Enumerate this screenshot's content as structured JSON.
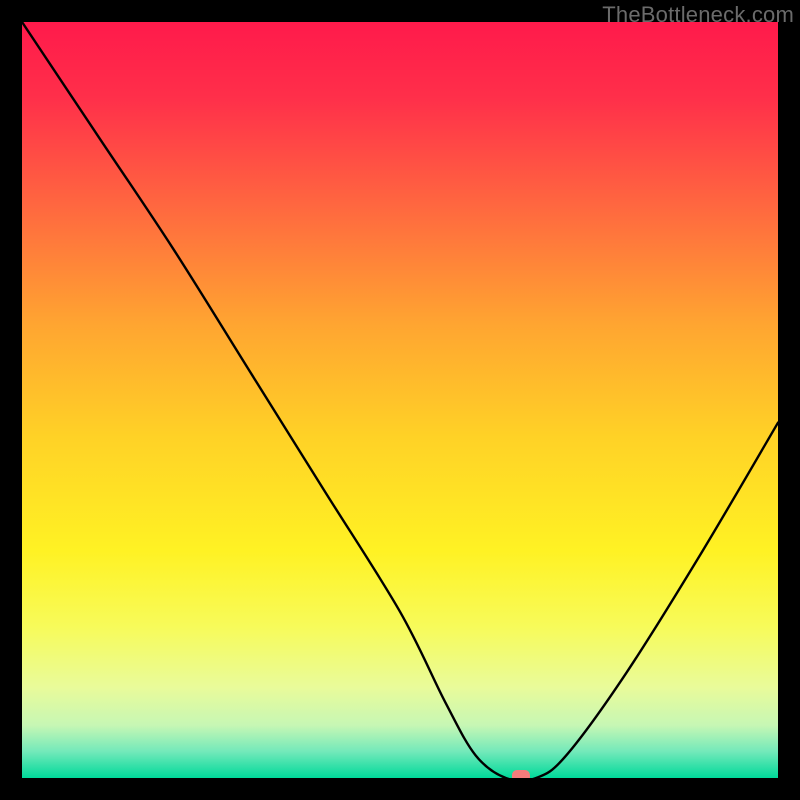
{
  "watermark": "TheBottleneck.com",
  "chart_data": {
    "type": "line",
    "title": "",
    "xlabel": "",
    "ylabel": "",
    "xlim": [
      0,
      100
    ],
    "ylim": [
      0,
      100
    ],
    "series": [
      {
        "name": "bottleneck-curve",
        "x": [
          0,
          10,
          20,
          30,
          40,
          50,
          56,
          60,
          64,
          68,
          72,
          80,
          90,
          100
        ],
        "y": [
          100,
          85,
          70,
          54,
          38,
          22,
          10,
          3,
          0,
          0,
          3,
          14,
          30,
          47
        ]
      }
    ],
    "marker": {
      "x": 66,
      "y": 0,
      "color": "#f47c7c"
    },
    "background_gradient": {
      "stops": [
        {
          "offset": 0.0,
          "color": "#ff1a4b"
        },
        {
          "offset": 0.1,
          "color": "#ff2f4a"
        },
        {
          "offset": 0.25,
          "color": "#ff6a3f"
        },
        {
          "offset": 0.4,
          "color": "#ffa531"
        },
        {
          "offset": 0.55,
          "color": "#ffd226"
        },
        {
          "offset": 0.7,
          "color": "#fff224"
        },
        {
          "offset": 0.8,
          "color": "#f7fb5a"
        },
        {
          "offset": 0.88,
          "color": "#e9fb9a"
        },
        {
          "offset": 0.93,
          "color": "#c7f7b4"
        },
        {
          "offset": 0.965,
          "color": "#73e9ba"
        },
        {
          "offset": 1.0,
          "color": "#00d99a"
        }
      ]
    }
  }
}
